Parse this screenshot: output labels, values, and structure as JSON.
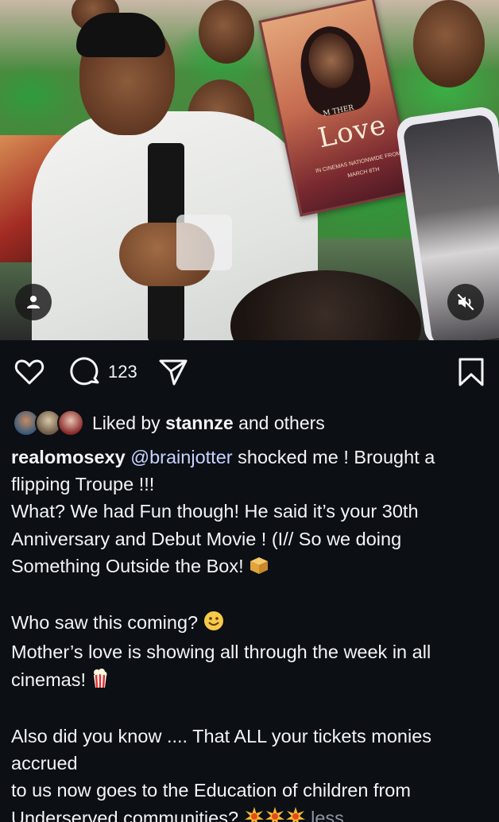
{
  "post": {
    "comment_count": "123",
    "liked_by_prefix": "Liked by ",
    "liked_by_user": "stannze",
    "liked_by_suffix": " and others",
    "author": "realomosexy",
    "caption": {
      "mention": "@brainjotter",
      "line1_rest": " shocked me ! Brought a flipping Troupe !!!",
      "line2": "What? We had Fun though! He said it’s your 30th Anniversary and Debut Movie ! (I// So we doing Something Outside the Box! ",
      "line3": "Who saw this coming? ",
      "line4": "Mother’s love is showing all through the week in all cinemas! ",
      "line5": "Also did you know .... That ALL your tickets monies accrued",
      "line6": "to us now goes to the Education of children from Underserved communities? ",
      "less_label": "less"
    }
  },
  "media": {
    "poster_title": "Love",
    "poster_small_title": "M  THER",
    "poster_release": "IN CINEMAS NATIONWIDE FROM",
    "poster_date": "MARCH 8TH"
  },
  "icons": {
    "like": "heart-outline-icon",
    "comment": "speech-bubble-icon",
    "share": "paper-plane-icon",
    "save": "bookmark-icon",
    "tags": "person-tag-icon",
    "mute": "speaker-muted-icon",
    "emoji_box": "package-emoji",
    "emoji_smile": "smiling-face-emoji",
    "emoji_popcorn": "popcorn-emoji",
    "emoji_collision": "collision-emoji"
  },
  "colors": {
    "background": "#0c0f14",
    "text": "#f3f5f7",
    "mention": "#c9d3ff",
    "muted": "#8e96a3"
  }
}
